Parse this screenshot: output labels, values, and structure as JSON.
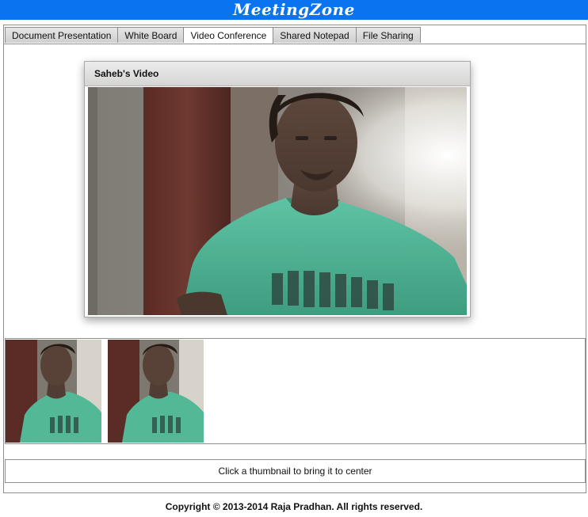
{
  "app": {
    "title": "MeetingZone"
  },
  "tabs": [
    {
      "label": "Document Presentation",
      "active": false
    },
    {
      "label": "White Board",
      "active": false
    },
    {
      "label": "Video Conference",
      "active": true
    },
    {
      "label": "Shared Notepad",
      "active": false
    },
    {
      "label": "File Sharing",
      "active": false
    }
  ],
  "video_panel": {
    "title": "Saheb's Video"
  },
  "thumbnails": {
    "hint": "Click a thumbnail to bring it to center"
  },
  "footer": {
    "copyright": "Copyright © 2013-2014  Raja Pradhan. All rights reserved."
  },
  "colors": {
    "header_bg": "#0a74f0",
    "shirt": "#4fb99a"
  }
}
